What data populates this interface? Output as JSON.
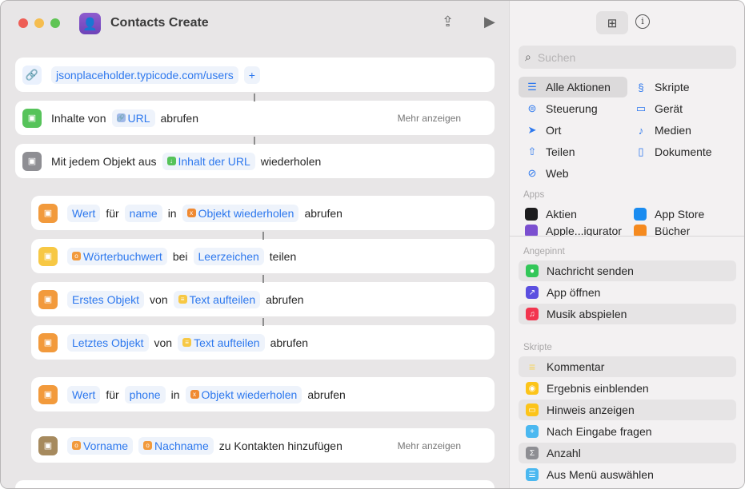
{
  "window": {
    "title": "Contacts Create"
  },
  "editor": {
    "url_action": {
      "url": "jsonplaceholder.typicode.com/users",
      "add": "+"
    },
    "actions": [
      {
        "icon": "download-icon",
        "color": "#56c35a",
        "tokens": [
          {
            "t": "Inhalte von"
          },
          {
            "p": "URL",
            "pc": "#9fb8e8",
            "pg": "🔗"
          },
          {
            "t": "abrufen"
          }
        ],
        "more": "Mehr anzeigen"
      },
      {
        "icon": "repeat-icon",
        "color": "#8e8e93",
        "tokens": [
          {
            "t": "Mit jedem Objekt aus"
          },
          {
            "p": "Inhalt der URL",
            "pc": "#56c35a",
            "pg": "↓"
          },
          {
            "t": "wiederholen"
          }
        ]
      },
      {
        "icon": "dictionary-icon",
        "color": "#f29a3c",
        "indent": true,
        "tokens": [
          {
            "p": "Wert"
          },
          {
            "t": "für"
          },
          {
            "p": "name"
          },
          {
            "t": "in"
          },
          {
            "p": "Objekt wiederholen",
            "pc": "#f08a32",
            "pg": "x"
          },
          {
            "t": "abrufen"
          }
        ]
      },
      {
        "icon": "text-split-icon",
        "color": "#f7c844",
        "indent": true,
        "tokens": [
          {
            "p": "Wörterbuchwert",
            "pc": "#f29a3c",
            "pg": "o"
          },
          {
            "t": "bei"
          },
          {
            "p": "Leerzeichen"
          },
          {
            "t": "teilen"
          }
        ]
      },
      {
        "icon": "list-icon",
        "color": "#f29a3c",
        "indent": true,
        "tokens": [
          {
            "p": "Erstes Objekt"
          },
          {
            "t": "von"
          },
          {
            "p": "Text aufteilen",
            "pc": "#f7c844",
            "pg": "≡"
          },
          {
            "t": "abrufen"
          }
        ]
      },
      {
        "icon": "list-icon",
        "color": "#f29a3c",
        "indent": true,
        "tokens": [
          {
            "p": "Letztes Objekt"
          },
          {
            "t": "von"
          },
          {
            "p": "Text aufteilen",
            "pc": "#f7c844",
            "pg": "≡"
          },
          {
            "t": "abrufen"
          }
        ]
      },
      {
        "icon": "dictionary-icon",
        "color": "#f29a3c",
        "indent": true,
        "tokens": [
          {
            "p": "Wert"
          },
          {
            "t": "für"
          },
          {
            "p": "phone"
          },
          {
            "t": "in"
          },
          {
            "p": "Objekt wiederholen",
            "pc": "#f08a32",
            "pg": "x"
          },
          {
            "t": "abrufen"
          }
        ]
      },
      {
        "icon": "contacts-icon",
        "color": "#a68a5e",
        "indent": true,
        "tokens": [
          {
            "p": "Vorname",
            "pc": "#f29a3c",
            "pg": "o"
          },
          {
            "p": "Nachname",
            "pc": "#f29a3c",
            "pg": "o"
          },
          {
            "t": "zu Kontakten hinzufügen"
          }
        ],
        "more": "Mehr anzeigen"
      }
    ]
  },
  "library": {
    "search_placeholder": "Suchen",
    "categories": [
      {
        "label": "Alle Aktionen",
        "glyph": "☰",
        "selected": true
      },
      {
        "label": "Skripte",
        "glyph": "§"
      },
      {
        "label": "Steuerung",
        "glyph": "⊜"
      },
      {
        "label": "Gerät",
        "glyph": "▭"
      },
      {
        "label": "Ort",
        "glyph": "➤"
      },
      {
        "label": "Medien",
        "glyph": "♪"
      },
      {
        "label": "Teilen",
        "glyph": "⇧"
      },
      {
        "label": "Dokumente",
        "glyph": "▯"
      },
      {
        "label": "Web",
        "glyph": "⊘"
      }
    ],
    "apps_header": "Apps",
    "apps": [
      {
        "label": "Aktien",
        "color": "#1c1c1e"
      },
      {
        "label": "App Store",
        "color": "#1a8cf0"
      },
      {
        "label": "Apple...igurator",
        "color": "#7b4fd0"
      },
      {
        "label": "Bücher",
        "color": "#f58a1f"
      }
    ],
    "pinned_header": "Angepinnt",
    "pinned": [
      {
        "label": "Nachricht senden",
        "color": "#33c759",
        "glyph": "●"
      },
      {
        "label": "App öffnen",
        "color": "#5b4fe0",
        "glyph": "↗"
      },
      {
        "label": "Musik abspielen",
        "color": "#f2354f",
        "glyph": "♫"
      }
    ],
    "scripts_header": "Skripte",
    "scripts": [
      {
        "label": "Kommentar",
        "color": "#f5d35a",
        "glyph": "≡"
      },
      {
        "label": "Ergebnis einblenden",
        "color": "#fcc419",
        "glyph": "◉"
      },
      {
        "label": "Hinweis anzeigen",
        "color": "#fcc419",
        "glyph": "▭"
      },
      {
        "label": "Nach Eingabe fragen",
        "color": "#4bb8f0",
        "glyph": "+"
      },
      {
        "label": "Anzahl",
        "color": "#8e8e93",
        "glyph": "Σ"
      },
      {
        "label": "Aus Menü auswählen",
        "color": "#4bb8f0",
        "glyph": "☰"
      }
    ]
  }
}
